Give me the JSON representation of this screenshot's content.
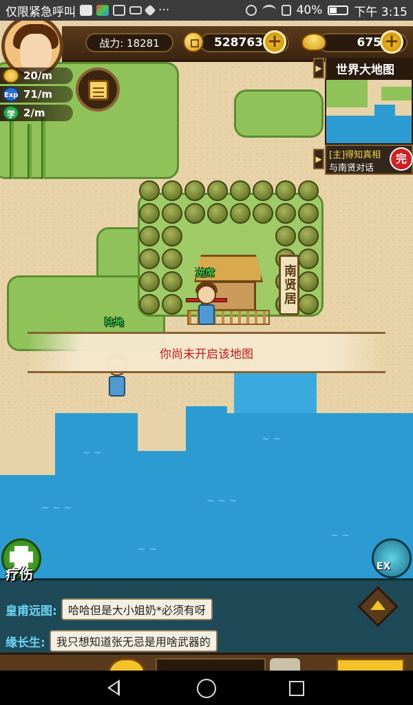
{
  "status_bar": {
    "carrier_text": "仅限紧急呼叫",
    "more": "···",
    "battery_percent": 40,
    "battery_text": "40%",
    "time": "下午 3:15"
  },
  "hud": {
    "combat_power": "战力: 18281",
    "gold": "528763",
    "ingots": "675",
    "rates": [
      {
        "icon": "coin-icon",
        "value": "20/m"
      },
      {
        "icon": "exp-icon",
        "label": "Exp",
        "value": "71/m"
      },
      {
        "icon": "study-icon",
        "label": "学",
        "value": "2/m"
      }
    ]
  },
  "minimap": {
    "title": "世界大地图",
    "quest_line1": "[主]得知真相",
    "quest_line2": "与南贤对话",
    "quest_badge": "完"
  },
  "map": {
    "sign_text": "南贤居",
    "npc_name": "逆席",
    "player_label": "陆地"
  },
  "toast": {
    "message": "你尚未开启该地图"
  },
  "buttons": {
    "heal_label": "疗伤",
    "ex_label": "EX"
  },
  "chat": {
    "messages": [
      {
        "name": "皇甫远图:",
        "text": "哈哈但是大小姐奶*必须有呀"
      },
      {
        "name": "缘长生:",
        "text": "我只想知道张无忌是用啥武器的"
      }
    ]
  }
}
